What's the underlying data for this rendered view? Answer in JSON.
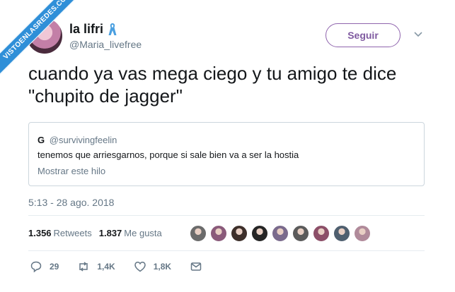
{
  "watermark": {
    "text": "VISTOENLASREDES.COM"
  },
  "tweet": {
    "author_name": "la lifri",
    "author_handle": "@Maria_livefree",
    "follow_label": "Seguir",
    "text_line1": "cuando ya vas mega ciego y tu amigo te dice",
    "text_line2": "\"chupito de jagger\"",
    "timestamp": "5:13 - 28 ago. 2018"
  },
  "quoted": {
    "name": "G",
    "handle": "@survivingfeelin",
    "text": "tenemos que arriesgarnos, porque si sale bien va a ser la hostia",
    "link": "Mostrar este hilo"
  },
  "stats": {
    "retweets_count": "1.356",
    "retweets_label": "Retweets",
    "likes_count": "1.837",
    "likes_label": "Me gusta"
  },
  "actions": {
    "replies": "29",
    "retweets": "1,4K",
    "likes": "1,8K"
  },
  "colors": {
    "accent": "#8f64ad",
    "ribbon": "#2f8fd8",
    "secondary_text": "#657786",
    "border": "#ccd6dd"
  },
  "likers": [
    "#6b6b6b",
    "#8a5a7a",
    "#3d2f2a",
    "#252525",
    "#7a6a8c",
    "#5b5b5b",
    "#8c4f68",
    "#4f5f6f",
    "#b08a9a"
  ]
}
